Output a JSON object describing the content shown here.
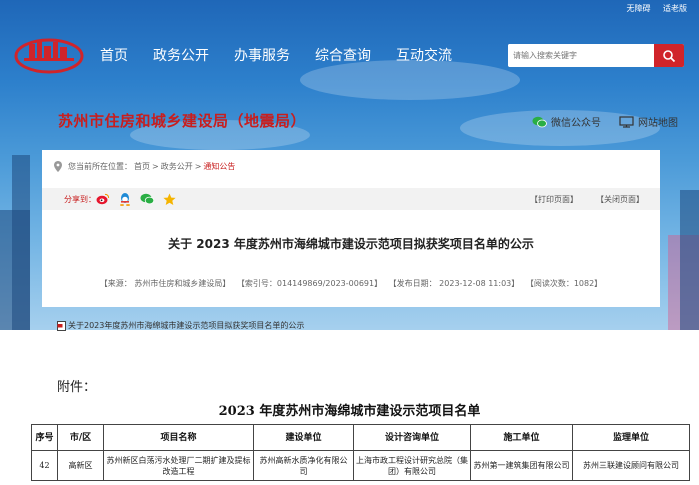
{
  "header": {
    "top_links": [
      "无障碍",
      "适老版"
    ],
    "nav": [
      "首页",
      "政务公开",
      "办事服务",
      "综合查询",
      "互动交流"
    ],
    "search_placeholder": "请输入搜索关键字",
    "bureau_name": "苏州市住房和城乡建设局（地震局）",
    "wechat_label": "微信公众号",
    "sitemap_label": "网站地图"
  },
  "breadcrumb": {
    "prefix": "您当前所在位置：",
    "items": [
      "首页",
      "政务公开",
      "通知公告"
    ],
    "sep": ">"
  },
  "toolbar": {
    "share_label": "分享到：",
    "share_icons": [
      "weibo-icon",
      "qq-icon",
      "wechat-icon",
      "favorite-star-icon"
    ],
    "print_label": "【打印页面】",
    "close_label": "【关闭页面】"
  },
  "article": {
    "title": "关于  2023  年度苏州市海绵城市建设示范项目拟获奖项目名单的公示",
    "meta": {
      "source": "【来源：  苏州市住房和城乡建设局】",
      "index_no": "【索引号：014149869/2023-00691】",
      "publish_time": "【发布日期：  2023-12-08 11:03】",
      "views": "【阅读次数：1082】"
    },
    "attachment": "关于2023年度苏州市海绵城市建设示范项目拟获奖项目名单的公示"
  },
  "document": {
    "fujian": "附件：",
    "title": "2023 年度苏州市海绵城市建设示范项目名单",
    "columns": [
      "序号",
      "市/区",
      "项目名称",
      "建设单位",
      "设计咨询单位",
      "施工单位",
      "监理单位"
    ],
    "rows": [
      [
        "42",
        "高新区",
        "苏州新区白荡污水处理厂二期扩建及提标改造工程",
        "苏州高新水质净化有限公司",
        "上海市政工程设计研究总院（集团）有限公司",
        "苏州第一建筑集团有限公司",
        "苏州三联建设顾问有限公司"
      ]
    ]
  },
  "colors": {
    "accent_red": "#c81e1e",
    "header_blue": "#2d80cc"
  }
}
